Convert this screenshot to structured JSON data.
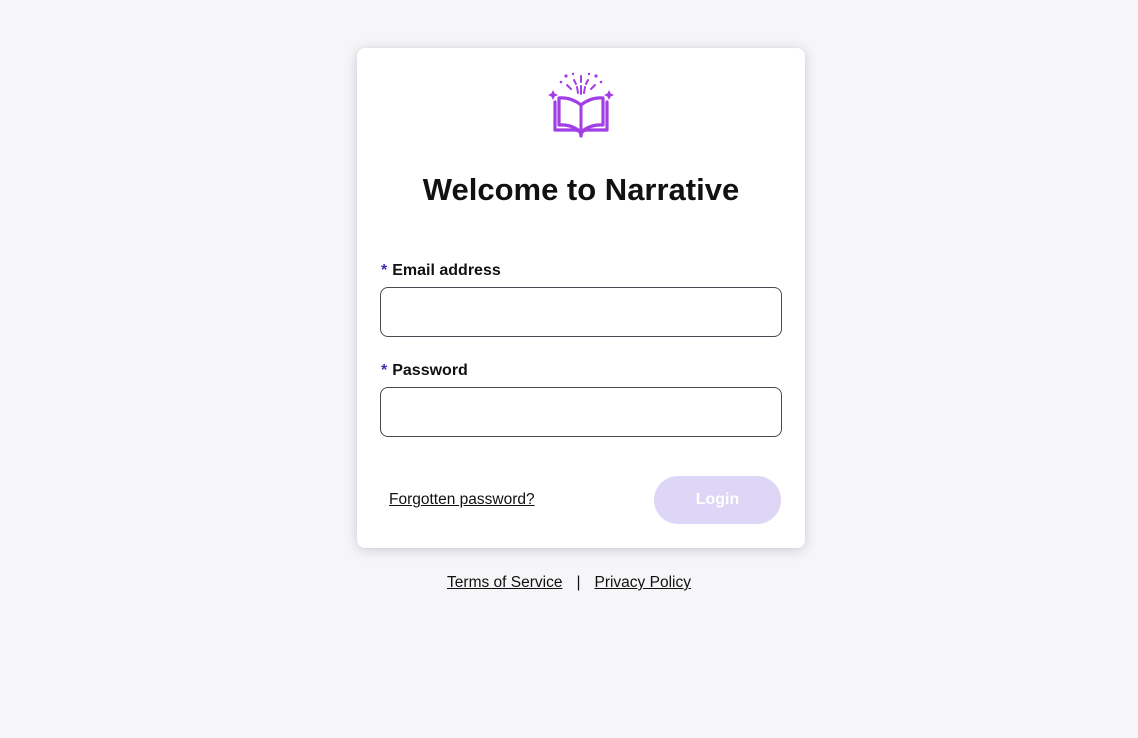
{
  "login_card": {
    "logo_icon": "open-book-sparkles-icon",
    "title": "Welcome to Narrative",
    "email": {
      "required_marker": "*",
      "label": "Email address",
      "value": "",
      "placeholder": ""
    },
    "password": {
      "required_marker": "*",
      "label": "Password",
      "value": "",
      "placeholder": ""
    },
    "forgot_password_link": "Forgotten password?",
    "login_button": "Login"
  },
  "footer": {
    "terms_link": "Terms of Service",
    "separator": "|",
    "privacy_link": "Privacy Policy"
  },
  "colors": {
    "background": "#f6f6f8",
    "brand_purple": "#a23ee6",
    "required_marker": "#3a2fb5",
    "login_button_disabled": "#ddd6f6"
  }
}
